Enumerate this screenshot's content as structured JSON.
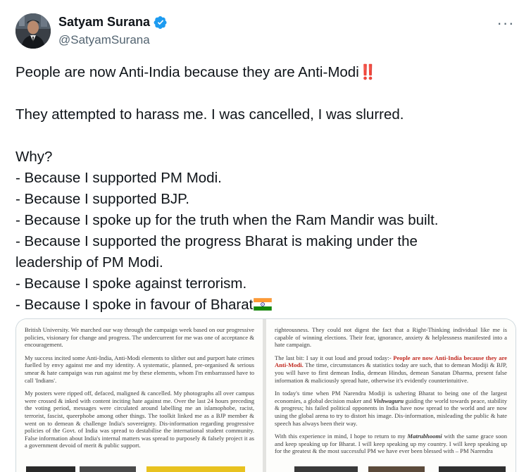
{
  "author": {
    "display_name": "Satyam Surana",
    "handle": "@SatyamSurana",
    "verified_icon": "verified-badge-icon",
    "verified_color": "#1d9bf0"
  },
  "more_icon": "more-options-icon",
  "tweet": {
    "line_1": "People are now Anti-India because they are Anti-Modi",
    "line_1_emoji": "‼️",
    "line_2": "They attempted to harass me. I was cancelled, I was slurred.",
    "line_3": "Why?",
    "line_4": "- Because I supported PM Modi.",
    "line_5": "- Because I supported BJP.",
    "line_6": "- Because I spoke up for the truth when the Ram Mandir was built.",
    "line_7": "- Because I supported the progress Bharat is making under the",
    "line_8": "leadership of PM Modi.",
    "line_9": "- Because I spoke against terrorism.",
    "line_10": "- Because I spoke in favour of Bharat",
    "flag_icon": "india-flag-icon"
  },
  "media": {
    "left": {
      "p1": "British University. We marched our way through the campaign week based on our progressive policies, visionary for change and progress. The undercurrent for me was one of acceptance & encouragement.",
      "p2": "My success incited some Anti-India, Anti-Modi elements to slither out and purport hate crimes fuelled by envy against me and my identity. A systematic, planned, pre-organised & serious smear & hate campaign was run against me by these elements, whom I'm embarrassed have to call 'Indians'.",
      "p3": "My posters were ripped off, defaced, maligned & cancelled. My photographs all over campus were crossed & inked with content inciting hate against me. Over the last 24 hours preceding the voting period, messages were circulated around labelling me an islamophobe, racist, terrorist, fascist, queerphobe among other things. The toolkit linked me as a BJP member & went on to demean & challenge India's sovereignty. Dis-information regarding progressive policies of the Govt. of India was spread to destabilise the international student community. False information about India's internal matters was spread to purposely & falsely project it as a government devoid of merit & public support."
    },
    "right": {
      "p1": "righteousness. They could not digest the fact that a Right-Thinking individual like me is capable of winning elections. Their fear, ignorance, anxiety & helplessness manifested into a hate campaign.",
      "p2_a": "The last bit: I say it out loud and proud today:- ",
      "p2_red": "People are now Anti-India because they are Anti-Modi.",
      "p2_b": " The time, circumstances & statistics today are such, that to demean Modiji & BJP, you will have to first demean India, demean Hindus, demean Sanatan Dharma, present false information & maliciously spread hate, otherwise it's evidently counterintuitive.",
      "p3_a": "In today's time when PM Narendra Modiji is ushering Bharat to being one of the largest economies, a global decision maker and ",
      "p3_ital": "Vishwaguru",
      "p3_b": " guiding the world towards peace, stability & progress; his failed political opponents in India have now spread to the world and are now using the global arena to try to distort his image. Dis-information, misleading the public & hate speech has always been their way.",
      "p4_a": "With this experience in mind, I hope to return to my ",
      "p4_ital": "Matrubhoomi",
      "p4_b": " with the same grace soon and keep speaking up for Bharat. I will keep speaking up my country. I will keep speaking up for the greatest & the most successful PM we have ever been blessed with – PM Narendra"
    }
  }
}
